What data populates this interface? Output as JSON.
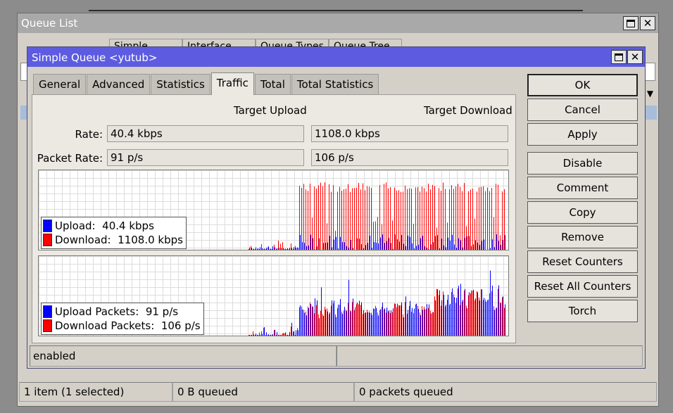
{
  "queue_window": {
    "title": "Queue List",
    "tabs": [
      "Simple Queues",
      "Interface Queues",
      "Queue Types",
      "Queue Tree"
    ],
    "status": [
      "1 item (1 selected)",
      "0 B queued",
      "0 packets queued"
    ]
  },
  "dialog": {
    "title": "Simple Queue <yutub>",
    "tabs": [
      "General",
      "Advanced",
      "Statistics",
      "Traffic",
      "Total",
      "Total Statistics"
    ],
    "active_tab": "Traffic",
    "headers": {
      "upload": "Target Upload",
      "download": "Target Download"
    },
    "rate": {
      "label": "Rate:",
      "upload": "40.4 kbps",
      "download": "1108.0 kbps"
    },
    "packet_rate": {
      "label": "Packet Rate:",
      "upload": "91 p/s",
      "download": "106 p/s"
    },
    "rate_graph": {
      "legend": [
        {
          "label": "Upload:",
          "value": "40.4 kbps",
          "color": "#0000ff"
        },
        {
          "label": "Download:",
          "value": "1108.0 kbps",
          "color": "#ff0000"
        }
      ]
    },
    "packet_graph": {
      "legend": [
        {
          "label": "Upload Packets:",
          "value": "91 p/s",
          "color": "#0000ff"
        },
        {
          "label": "Download Packets:",
          "value": "106 p/s",
          "color": "#ff0000"
        }
      ]
    },
    "buttons": [
      "OK",
      "Cancel",
      "Apply",
      "Disable",
      "Comment",
      "Copy",
      "Remove",
      "Reset Counters",
      "Reset All Counters",
      "Torch"
    ],
    "status": "enabled"
  },
  "colors": {
    "upload": "#0000ff",
    "download": "#ff0000",
    "title_active": "#5d5ce1",
    "title_inactive": "#a9a9a9"
  }
}
